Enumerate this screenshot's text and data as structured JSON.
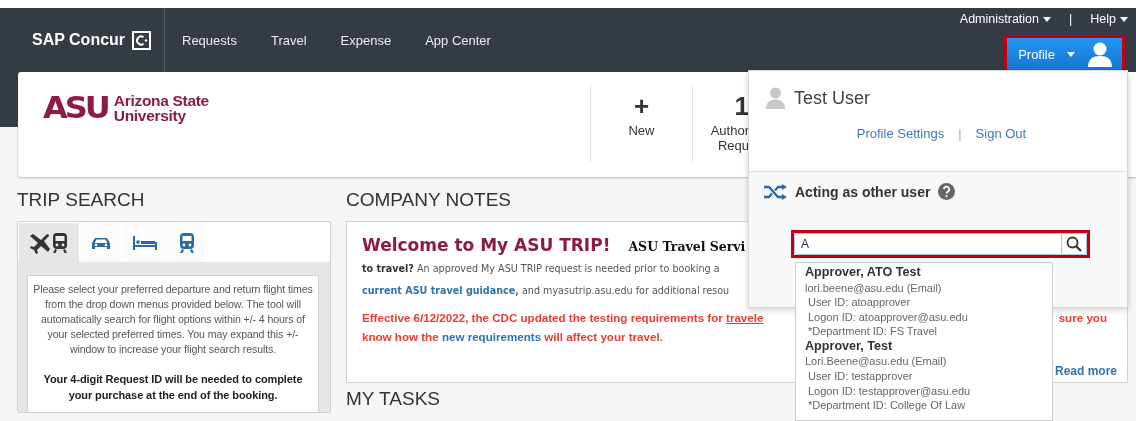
{
  "header": {
    "brand": "SAP Concur",
    "nav": [
      {
        "label": "Requests"
      },
      {
        "label": "Travel"
      },
      {
        "label": "Expense"
      },
      {
        "label": "App Center"
      }
    ],
    "utility": [
      {
        "label": "Administration"
      },
      {
        "label": "Help"
      }
    ],
    "separator": "|",
    "profile_button": {
      "label": "Profile",
      "highlighted": true
    }
  },
  "banner": {
    "logo_text": "ASU",
    "org_name": [
      "Arizona State",
      "University"
    ],
    "actions": [
      {
        "kind": "new",
        "glyph": "+",
        "label": [
          "New"
        ]
      },
      {
        "kind": "count",
        "glyph": "1",
        "label": [
          "Author",
          "Requ"
        ]
      }
    ]
  },
  "trip_search": {
    "title": "TRIP SEARCH",
    "tabs": [
      {
        "kind": "flight",
        "selected": true
      },
      {
        "kind": "car",
        "selected": false
      },
      {
        "kind": "hotel",
        "selected": false
      },
      {
        "kind": "rail",
        "selected": false
      }
    ],
    "instructions": "Please select your preferred departure and return flight times from the drop down menus provided below. The tool will automatically search for flight options within +/- 4 hours of your selected preferred times. You may expand this +/- window to increase your flight search results.",
    "notice": "Your 4-digit Request ID will be needed to complete your purchase at the end of the booking."
  },
  "company_notes": {
    "title": "COMPANY NOTES",
    "welcome": "Welcome to My ASU TRIP!",
    "subtitle": "ASU Travel Servi",
    "line_2": "**to travel?**  An approved My ASU TRIP request is needed prior to booking a",
    "line_3_link": "current ASU travel guidance,",
    "line_3_rest": " and myasutrip.asu.edu for additional resou",
    "alert_1": " Effective 6/12/2022, the CDC updated the  testing requirements for ",
    "alert_1_link": "travele",
    "alert_1_end": "sure you",
    "alert_2": "know how the ",
    "alert_2_link": "new requirements",
    "alert_2_rest": " will affect your travel.",
    "read_more": "Read more"
  },
  "tasks": {
    "title": "MY TASKS"
  },
  "profile_panel": {
    "user_name": "Test User",
    "links": [
      {
        "label": "Profile Settings"
      },
      {
        "label": "Sign Out"
      }
    ],
    "separator": "|",
    "acting_title": "Acting as other user",
    "search": {
      "value": "A",
      "highlighted": true
    },
    "results": [
      {
        "name": "Approver, ATO Test",
        "details": [
          "lori.beene@asu.edu (Email)",
          "User ID: atoapprover",
          "Logon ID: atoapprover@asu.edu",
          "*Department ID: FS Travel"
        ]
      },
      {
        "name": "Approver, Test",
        "details": [
          "Lori.Beene@asu.edu (Email)",
          "User ID: testapprover",
          "Logon ID: testapprover@asu.edu",
          "*Department ID: College Of Law"
        ]
      }
    ]
  }
}
